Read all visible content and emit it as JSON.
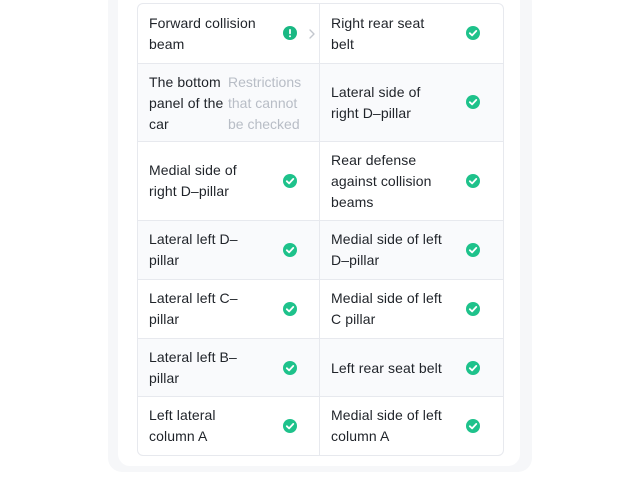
{
  "checks": [
    {
      "left": {
        "label": "Forward collision beam",
        "status": "warning",
        "icon": "exclamation-circle-icon",
        "has_arrow": true
      },
      "right": {
        "label": "Right rear seat belt",
        "status": "ok",
        "icon": "check-circle-icon"
      }
    },
    {
      "left": {
        "label": "The bottom panel of the car",
        "status_text": "Restrictions that cannot be checked"
      },
      "right": {
        "label": "Lateral side of right D–pillar",
        "status": "ok",
        "icon": "check-circle-icon"
      }
    },
    {
      "left": {
        "label": "Medial side of right D–pillar",
        "status": "ok",
        "icon": "check-circle-icon"
      },
      "right": {
        "label": "Rear defense against collision beams",
        "status": "ok",
        "icon": "check-circle-icon"
      }
    },
    {
      "left": {
        "label": "Lateral left D–pillar",
        "status": "ok",
        "icon": "check-circle-icon"
      },
      "right": {
        "label": "Medial side of left D–pillar",
        "status": "ok",
        "icon": "check-circle-icon"
      }
    },
    {
      "left": {
        "label": "Lateral left C–pillar",
        "status": "ok",
        "icon": "check-circle-icon"
      },
      "right": {
        "label": "Medial side of left C pillar",
        "status": "ok",
        "icon": "check-circle-icon"
      }
    },
    {
      "left": {
        "label": "Lateral left B–pillar",
        "status": "ok",
        "icon": "check-circle-icon"
      },
      "right": {
        "label": "Left rear seat belt",
        "status": "ok",
        "icon": "check-circle-icon"
      }
    },
    {
      "left": {
        "label": "Left lateral column A",
        "status": "ok",
        "icon": "check-circle-icon"
      },
      "right": {
        "label": "Medial side of left column A",
        "status": "ok",
        "icon": "check-circle-icon"
      }
    }
  ],
  "colors": {
    "ok": "#1ec28b",
    "warning": "#19b883",
    "text": "#1f2329",
    "muted_text": "#b8bdc6",
    "border": "#e7e9ee"
  }
}
